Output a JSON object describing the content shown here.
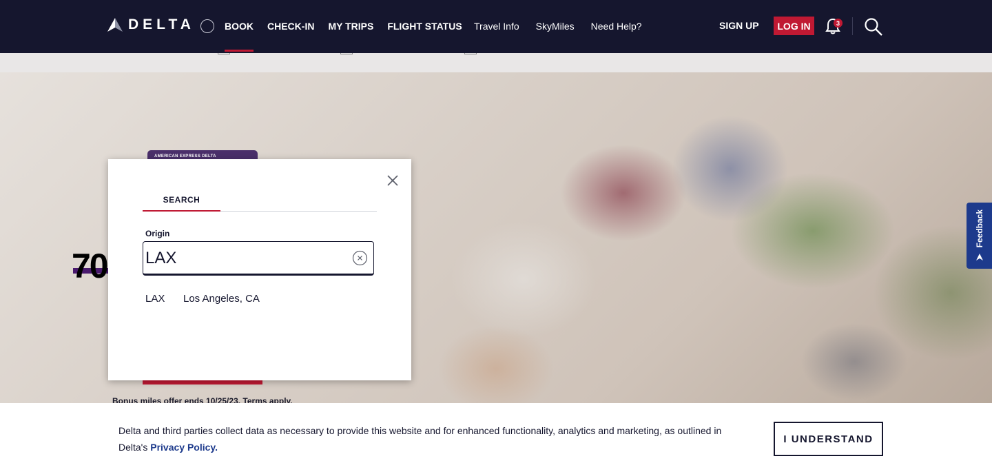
{
  "header": {
    "logo_text": "DELTA",
    "nav_primary": [
      {
        "label": "BOOK",
        "active": true
      },
      {
        "label": "CHECK-IN"
      },
      {
        "label": "MY TRIPS"
      },
      {
        "label": "FLIGHT STATUS"
      }
    ],
    "nav_secondary": [
      "Travel Info",
      "SkyMiles",
      "Need Help?"
    ],
    "signup_label": "SIGN UP",
    "login_label": "LOG IN",
    "notification_count": "3",
    "colors": {
      "background": "#15162e",
      "accent": "#c01933"
    }
  },
  "hero": {
    "card_label": "AMERICAN EXPRESS   DELTA",
    "promo_big": "70",
    "promo_terms": "Bonus miles offer ends 10/25/23. Terms apply."
  },
  "feedback": {
    "label": "Feedback"
  },
  "modal": {
    "tab_label": "SEARCH",
    "field_label": "Origin",
    "field_value": "LAX",
    "suggestion": {
      "code": "LAX",
      "city": "Los Angeles, CA"
    }
  },
  "cookie": {
    "text_before": "Delta and third parties collect data as necessary to provide this website and for enhanced functionality, analytics and marketing, as outlined in Delta's ",
    "link_label": "Privacy Policy.",
    "button_label": "I UNDERSTAND"
  }
}
